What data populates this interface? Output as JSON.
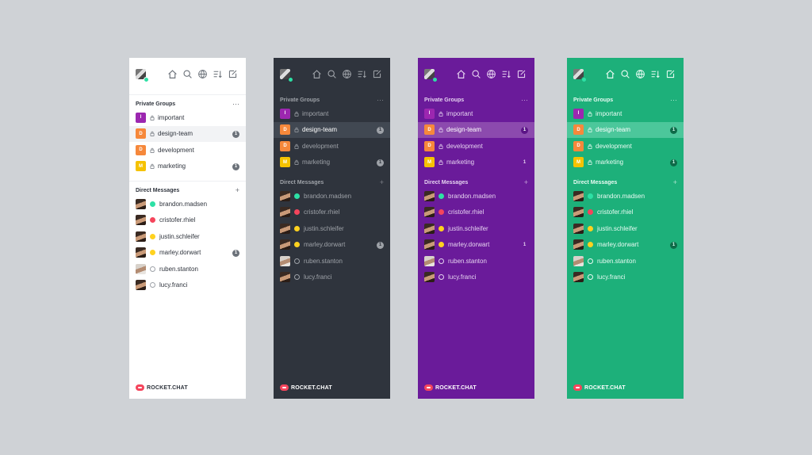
{
  "colors": {
    "background": "#cfd2d6",
    "light": "#ffffff",
    "dark": "#2f343d",
    "purple": "#6a1b9a",
    "green": "#1db07a"
  },
  "panels": [
    {
      "theme": "light"
    },
    {
      "theme": "dark"
    },
    {
      "theme": "purple"
    },
    {
      "theme": "green"
    }
  ],
  "header": {
    "icons": [
      "home-icon",
      "search-icon",
      "globe-icon",
      "sort-icon",
      "compose-icon"
    ]
  },
  "private_groups": {
    "title": "Private Groups",
    "items": [
      {
        "initial": "I",
        "name": "important",
        "color": "#9c27b0",
        "badge": ""
      },
      {
        "initial": "D",
        "name": "design-team",
        "color": "#f6883b",
        "badge": "1",
        "active": true
      },
      {
        "initial": "D",
        "name": "development",
        "color": "#f6883b",
        "badge": ""
      },
      {
        "initial": "M",
        "name": "marketing",
        "color": "#f5c200",
        "badge": "1"
      }
    ]
  },
  "direct_messages": {
    "title": "Direct Messages",
    "add_label": "+",
    "items": [
      {
        "name": "brandon.madsen",
        "status": "online",
        "badge": ""
      },
      {
        "name": "cristofer.rhiel",
        "status": "busy",
        "badge": ""
      },
      {
        "name": "justin.schleifer",
        "status": "away",
        "badge": ""
      },
      {
        "name": "marley.dorwart",
        "status": "away",
        "badge": "1"
      },
      {
        "name": "ruben.stanton",
        "status": "offline",
        "badge": ""
      },
      {
        "name": "lucy.franci",
        "status": "offline",
        "badge": ""
      }
    ]
  },
  "footer": {
    "logo_text": "ROCKET.CHAT"
  }
}
